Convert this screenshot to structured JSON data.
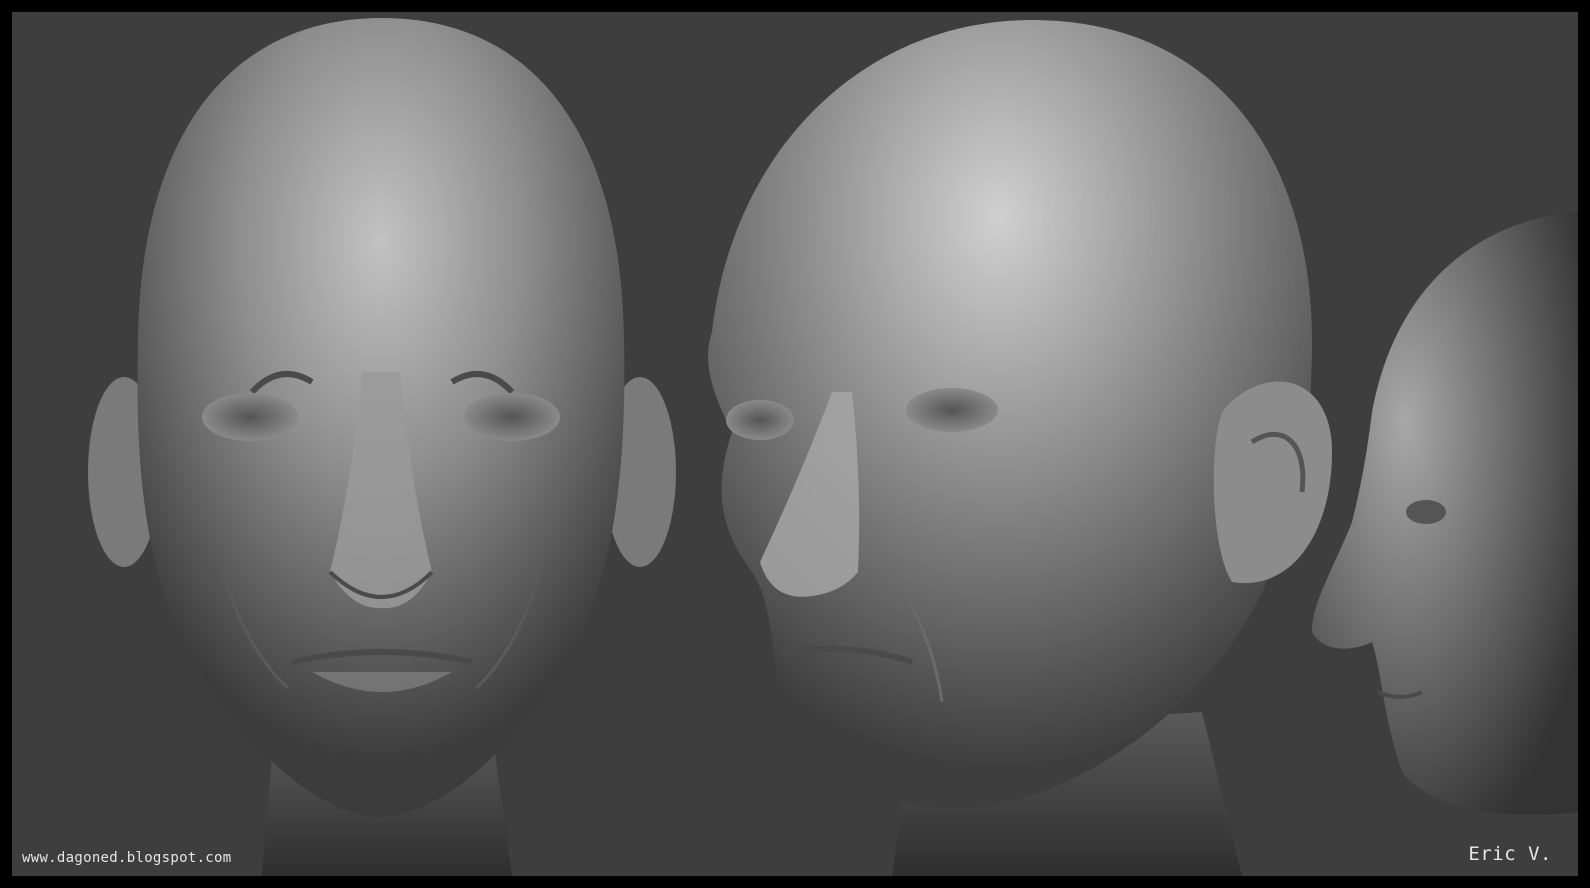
{
  "render": {
    "background_color": "#3e3e3e",
    "frame_color": "#000000",
    "clay_highlight": "#bdbdbd",
    "clay_mid": "#7d7d7d",
    "clay_shadow": "#3a3a3a"
  },
  "captions": {
    "website": "www.dagoned.blogspot.com",
    "artist": "Eric V."
  },
  "sculpt_views": [
    {
      "view": "front"
    },
    {
      "view": "three-quarter"
    },
    {
      "view": "side"
    }
  ]
}
